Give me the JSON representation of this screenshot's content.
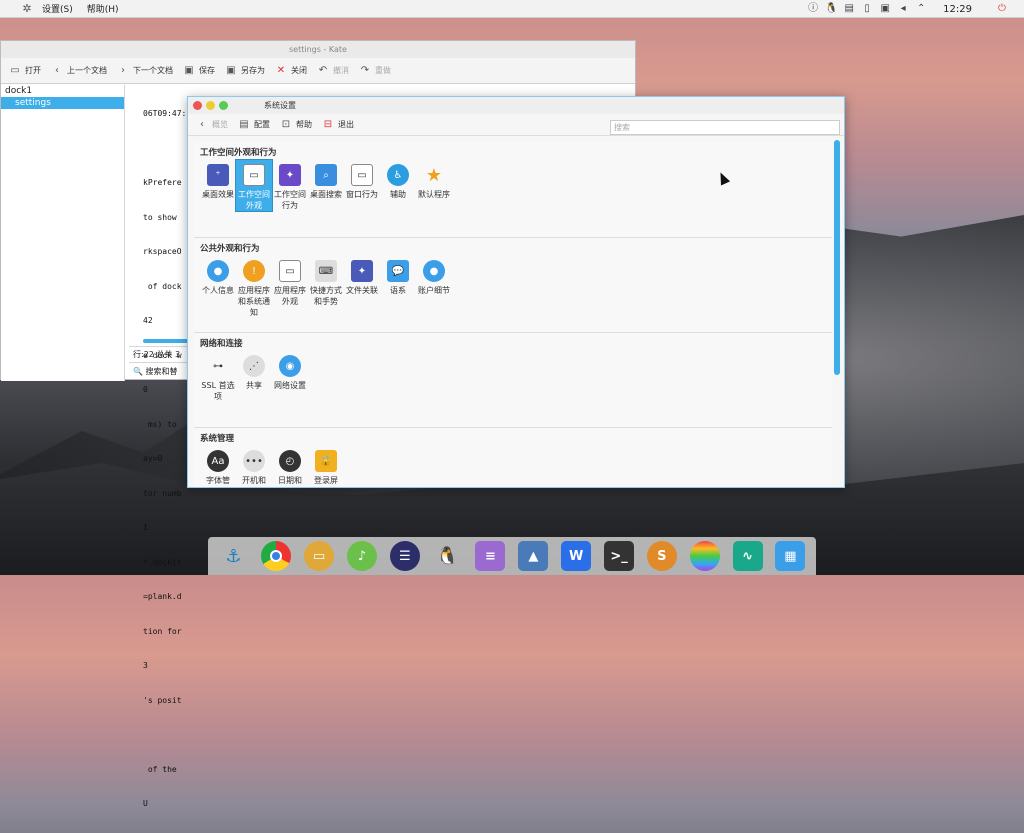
{
  "top_panel": {
    "menu": [
      "设置(S)",
      "帮助(H)"
    ],
    "clock": "12:29",
    "tray_icons": [
      "info-icon",
      "qq-icon",
      "clipboard-icon",
      "phone-icon",
      "network-icon",
      "volume-icon",
      "chevron-up-icon",
      "power-icon"
    ]
  },
  "kate": {
    "title": "settings - Kate",
    "toolbar": [
      "打开",
      "上一个文档",
      "下一个文档",
      "保存",
      "另存为",
      "关闭",
      "撤消",
      "重做"
    ],
    "sidebar": [
      "dock1",
      "settings"
    ],
    "lines": [
      "06T09:47:52+0000",
      "",
      "kPrefere",
      "to show",
      "rkspaceO",
      " of dock",
      "42",
      "e dock w",
      "0",
      " ms) to",
      "ay=0",
      "tor numb",
      "1",
      "*.dockit",
      "=plank.d",
      "tion for",
      "3",
      "'s posit",
      "",
      " of the",
      "U"
    ],
    "status": "行:22 总共 3",
    "search": "搜索和替"
  },
  "settings": {
    "title": "系统设置",
    "toolbar": {
      "back": "概览",
      "config": "配置",
      "help": "帮助",
      "quit": "退出"
    },
    "search_placeholder": "搜索",
    "sections": [
      {
        "title": "工作空间外观和行为",
        "items": [
          "桌面效果",
          "工作空间外观",
          "工作空间行为",
          "桌面搜索",
          "窗口行为",
          "辅助",
          "默认程序"
        ]
      },
      {
        "title": "公共外观和行为",
        "items": [
          "个人信息",
          "应用程序和系统通知",
          "应用程序外观",
          "快捷方式和手势",
          "文件关联",
          "语系",
          "账户细节"
        ]
      },
      {
        "title": "网络和连接",
        "items": [
          "SSL 首选项",
          "共享",
          "网络设置"
        ]
      },
      {
        "title": "系统管理",
        "items": [
          "字体管",
          "开机和",
          "日期和",
          "登录屏"
        ]
      }
    ]
  },
  "dock": [
    "anchor-icon",
    "chrome-icon",
    "files-icon",
    "music-icon",
    "eclipse-icon",
    "qq-icon",
    "document-icon",
    "image-viewer-icon",
    "wps-icon",
    "terminal-icon",
    "sublime-icon",
    "rainbow-icon",
    "activity-monitor-icon",
    "screenshot-icon"
  ]
}
